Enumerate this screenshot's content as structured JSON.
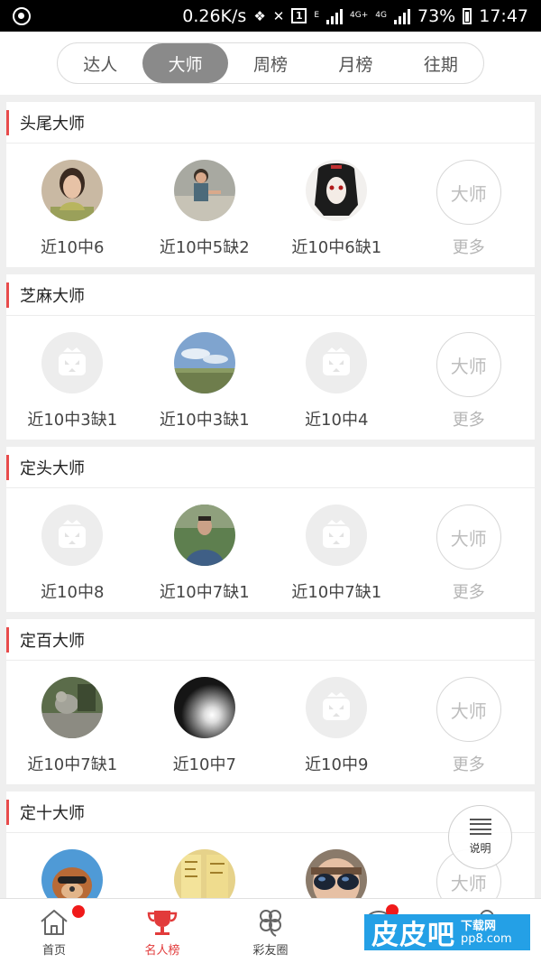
{
  "status_bar": {
    "speed": "0.26K/s",
    "battery": "73%",
    "time": "17:47",
    "net_a": "4G+",
    "net_b": "2G",
    "net_c": "4G",
    "sim": "1",
    "e_mark": "E"
  },
  "tabs": [
    {
      "label": "达人",
      "active": false
    },
    {
      "label": "大师",
      "active": true
    },
    {
      "label": "周榜",
      "active": false
    },
    {
      "label": "月榜",
      "active": false
    },
    {
      "label": "往期",
      "active": false
    }
  ],
  "sections": [
    {
      "title": "头尾大师",
      "items": [
        {
          "label": "近10中6",
          "avatar": "photo-woman"
        },
        {
          "label": "近10中5缺2",
          "avatar": "photo-child"
        },
        {
          "label": "近10中6缺1",
          "avatar": "photo-anime"
        }
      ],
      "more_badge": "大师",
      "more_label": "更多"
    },
    {
      "title": "芝麻大师",
      "items": [
        {
          "label": "近10中3缺1",
          "avatar": "placeholder"
        },
        {
          "label": "近10中3缺1",
          "avatar": "photo-sky"
        },
        {
          "label": "近10中4",
          "avatar": "placeholder"
        }
      ],
      "more_badge": "大师",
      "more_label": "更多"
    },
    {
      "title": "定头大师",
      "items": [
        {
          "label": "近10中8",
          "avatar": "placeholder"
        },
        {
          "label": "近10中7缺1",
          "avatar": "photo-man"
        },
        {
          "label": "近10中7缺1",
          "avatar": "placeholder"
        }
      ],
      "more_badge": "大师",
      "more_label": "更多"
    },
    {
      "title": "定百大师",
      "items": [
        {
          "label": "近10中7缺1",
          "avatar": "photo-bird"
        },
        {
          "label": "近10中7",
          "avatar": "photo-light"
        },
        {
          "label": "近10中9",
          "avatar": "placeholder"
        }
      ],
      "more_badge": "大师",
      "more_label": "更多"
    },
    {
      "title": "定十大师",
      "items": [
        {
          "label": "",
          "avatar": "photo-dog"
        },
        {
          "label": "",
          "avatar": "photo-paper"
        },
        {
          "label": "",
          "avatar": "photo-sunglasses"
        }
      ],
      "more_badge": "大师",
      "more_label": ""
    }
  ],
  "fab": {
    "label": "说明",
    "icon": "menu-list-icon"
  },
  "bottom_nav": [
    {
      "label": "首页",
      "icon": "home-icon",
      "badge": true,
      "active": false
    },
    {
      "label": "名人榜",
      "icon": "trophy-icon",
      "badge": false,
      "active": true
    },
    {
      "label": "彩友圈",
      "icon": "clover-icon",
      "badge": false,
      "active": false
    },
    {
      "label": "",
      "icon": "chat-icon",
      "badge": true,
      "active": false
    },
    {
      "label": "",
      "icon": "user-icon",
      "badge": false,
      "active": false
    }
  ],
  "watermark": {
    "main": "皮皮吧",
    "top": "下载网",
    "bottom": "pp8.com"
  },
  "colors": {
    "accent": "#e84b4b",
    "active_tab": "#8a8a8a",
    "badge": "#f01a1a",
    "watermark": "#24a0e6"
  }
}
